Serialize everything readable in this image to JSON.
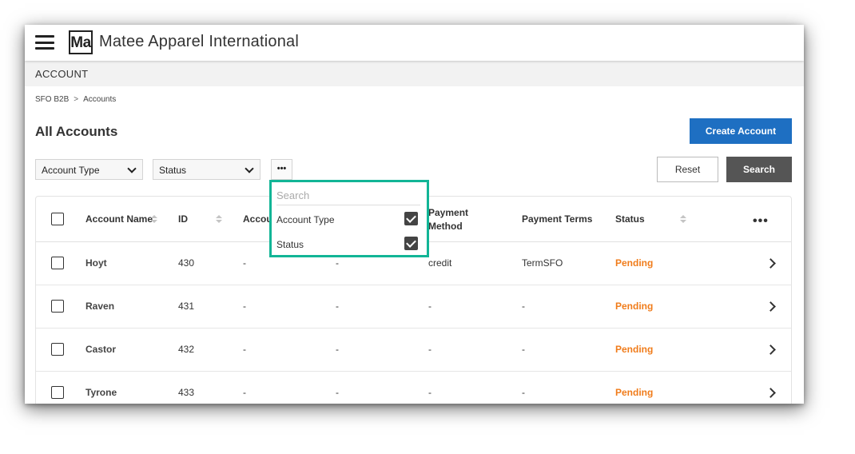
{
  "app": {
    "logo_text": "Ma",
    "name": "Matee Apparel International"
  },
  "section": {
    "title": "ACCOUNT"
  },
  "breadcrumb": {
    "items": [
      "SFO B2B",
      "Accounts"
    ],
    "separator": ">"
  },
  "page": {
    "title": "All Accounts",
    "create_button": "Create Account"
  },
  "filters": {
    "account_type": "Account Type",
    "status": "Status",
    "more": "•••",
    "reset": "Reset",
    "search": "Search"
  },
  "column_menu": {
    "search_placeholder": "Search",
    "items": [
      {
        "label": "Account Type",
        "checked": true
      },
      {
        "label": "Status",
        "checked": true
      }
    ],
    "highlight_color": "#12b596"
  },
  "table": {
    "headers": {
      "name": "Account Name",
      "id": "ID",
      "account_type": "Accou",
      "payment_method": "Payment Method",
      "payment_terms": "Payment Terms",
      "status": "Status",
      "more": "•••"
    },
    "rows": [
      {
        "name": "Hoyt",
        "id": "430",
        "account_type": "-",
        "col4": "-",
        "payment_method": "credit",
        "payment_terms": "TermSFO",
        "status": "Pending"
      },
      {
        "name": "Raven",
        "id": "431",
        "account_type": "-",
        "col4": "-",
        "payment_method": "-",
        "payment_terms": "-",
        "status": "Pending"
      },
      {
        "name": "Castor",
        "id": "432",
        "account_type": "-",
        "col4": "-",
        "payment_method": "-",
        "payment_terms": "-",
        "status": "Pending"
      },
      {
        "name": "Tyrone",
        "id": "433",
        "account_type": "-",
        "col4": "-",
        "payment_method": "-",
        "payment_terms": "-",
        "status": "Pending"
      }
    ]
  },
  "colors": {
    "primary": "#1e6fc2",
    "status_pending": "#f07c1b",
    "search_button": "#555555"
  }
}
